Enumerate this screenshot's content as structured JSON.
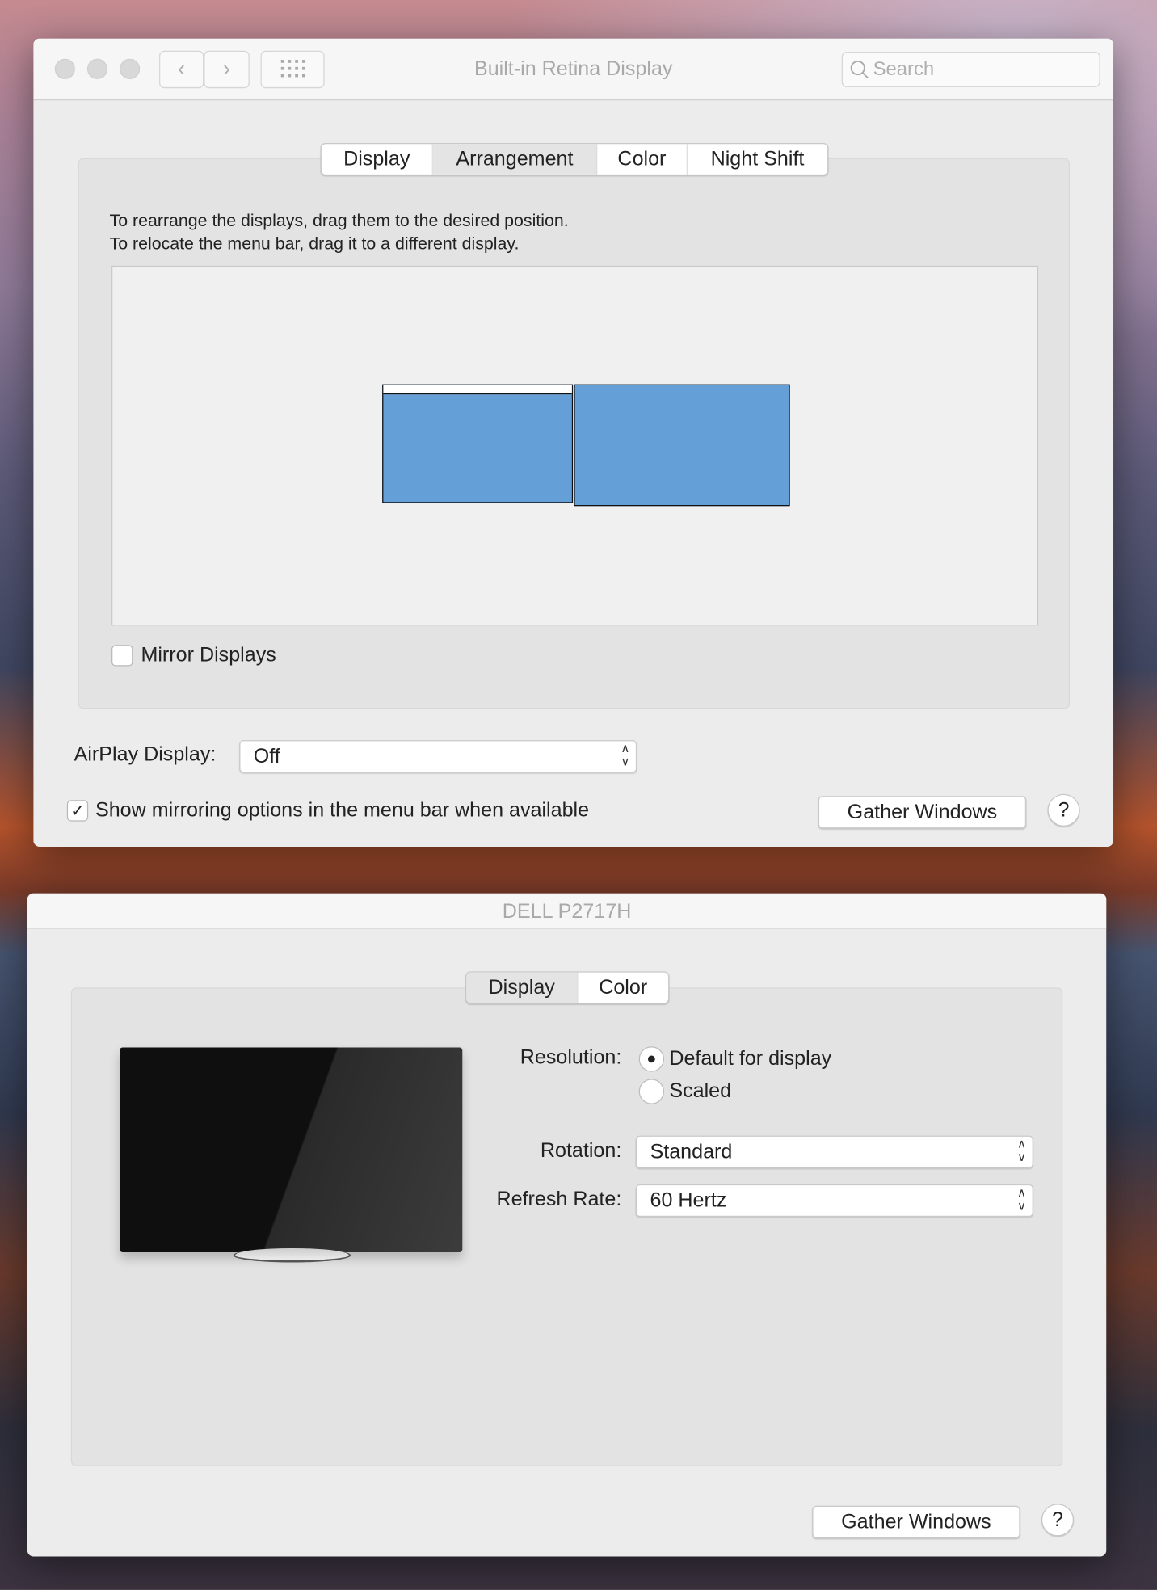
{
  "window1": {
    "title": "Built-in Retina Display",
    "search_placeholder": "Search",
    "tabs": [
      {
        "label": "Display"
      },
      {
        "label": "Arrangement"
      },
      {
        "label": "Color"
      },
      {
        "label": "Night Shift"
      }
    ],
    "selected_tab": "Arrangement",
    "instructions": [
      "To rearrange the displays, drag them to the desired position.",
      "To relocate the menu bar, drag it to a different display."
    ],
    "display_color": "#659fd8",
    "mirror_label": "Mirror Displays",
    "mirror_checked": false,
    "airplay_label": "AirPlay Display:",
    "airplay_value": "Off",
    "show_mirroring_label": "Show mirroring options in the menu bar when available",
    "show_mirroring_checked": true,
    "gather_label": "Gather Windows",
    "help_label": "?"
  },
  "window2": {
    "title": "DELL P2717H",
    "tabs": [
      {
        "label": "Display"
      },
      {
        "label": "Color"
      }
    ],
    "selected_tab": "Display",
    "resolution_label": "Resolution:",
    "resolution_options": [
      {
        "label": "Default for display",
        "selected": true
      },
      {
        "label": "Scaled",
        "selected": false
      }
    ],
    "rotation_label": "Rotation:",
    "rotation_value": "Standard",
    "refresh_label": "Refresh Rate:",
    "refresh_value": "60 Hertz",
    "gather_label": "Gather Windows",
    "help_label": "?"
  }
}
